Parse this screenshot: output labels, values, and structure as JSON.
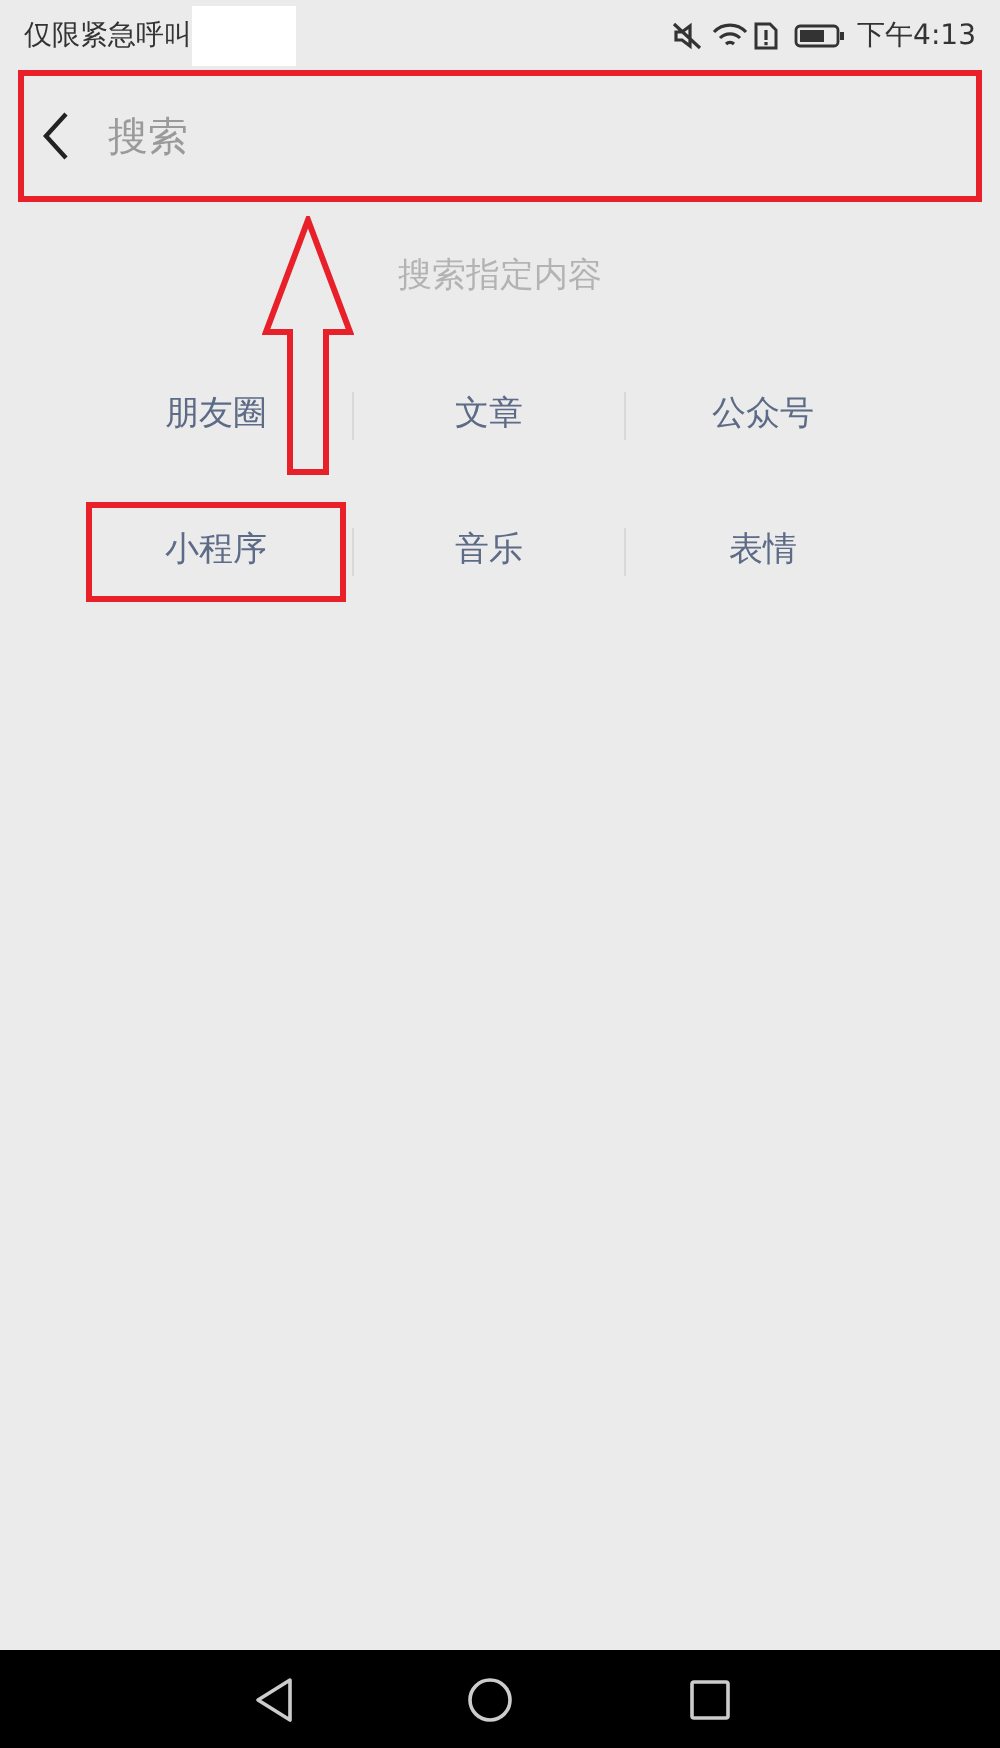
{
  "status_bar": {
    "carrier": "仅限紧急呼叫",
    "time": "下午4:13"
  },
  "search_bar": {
    "placeholder": "搜索",
    "highlighted": true
  },
  "hint": "搜索指定内容",
  "categories": [
    {
      "label": "朋友圈",
      "highlighted": false
    },
    {
      "label": "文章",
      "highlighted": false
    },
    {
      "label": "公众号",
      "highlighted": false
    },
    {
      "label": "小程序",
      "highlighted": true
    },
    {
      "label": "音乐",
      "highlighted": false
    },
    {
      "label": "表情",
      "highlighted": false
    }
  ]
}
